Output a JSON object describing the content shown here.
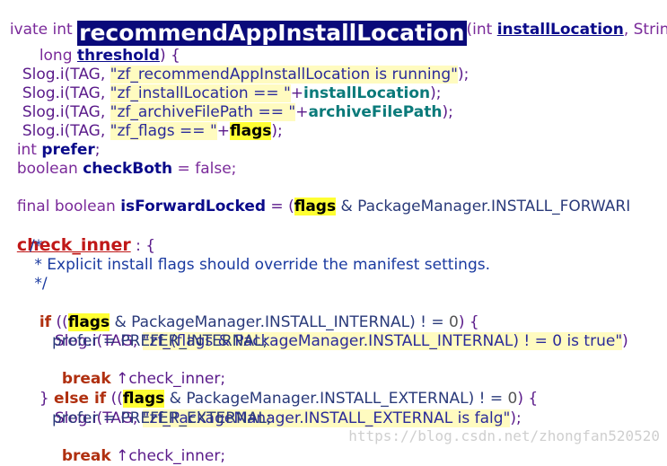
{
  "lines": {
    "l1": {
      "a": "ivate int ",
      "method": "recommendAppInstallLocation",
      "b": "(int ",
      "param1": "installLocation",
      "c": ", String"
    },
    "l2": {
      "a": "long ",
      "param": "threshold",
      "b": ") {"
    },
    "l3": {
      "a": "Slog.i(TAG, ",
      "s": "\"zf_recommendAppInstallLocation is running\"",
      "b": ");"
    },
    "l4": {
      "a": "Slog.i(TAG, ",
      "s": "\"zf_installLocation == \"",
      "plus": "+",
      "v": "installLocation",
      "b": ");"
    },
    "l5": {
      "a": "Slog.i(TAG, ",
      "s": "\"zf_archiveFilePath == \"",
      "plus": "+",
      "v": "archiveFilePath",
      "b": ");"
    },
    "l6": {
      "a": "Slog.i(TAG, ",
      "s": "\"zf_flags == \"",
      "plus": "+",
      "v": "flags",
      "b": ");"
    },
    "l7": {
      "a": "int ",
      "v": "prefer",
      "b": ";"
    },
    "l8": {
      "a": "boolean ",
      "v": "checkBoth",
      "b": " = false;"
    },
    "l9": {
      "a": "final boolean ",
      "v": "isForwardLocked",
      "b": " = (",
      "flags": "flags",
      "c": " & PackageManager.INSTALL_FORWARI"
    },
    "l10": {
      "label": "check_inner",
      "b": " : {"
    },
    "l11": {
      "t": "/*"
    },
    "l12": {
      "t": " * Explicit install flags should override the manifest settings."
    },
    "l13": {
      "t": " */"
    },
    "l14": {
      "if": "if",
      "a": " ((",
      "flags": "flags",
      "b": " & PackageManager.INSTALL_INTERNAL) ! = ",
      "num": "0",
      "c": ") {"
    },
    "l15": {
      "a": "Slog.i(TAG, ",
      "s": "\"zf_(flags & PackageManager.INSTALL_INTERNAL) ! = 0 is true\"",
      "b": ")"
    },
    "l16": {
      "a": "prefer = PREFER_INTERNAL;"
    },
    "l17": {
      "kw": "break",
      "b": " ↑check_inner;"
    },
    "l18": {
      "a": "} ",
      "elseif": "else if",
      "b": " ((",
      "flags": "flags",
      "c": " & PackageManager.INSTALL_EXTERNAL) ! = ",
      "num": "0",
      "d": ") {"
    },
    "l19": {
      "a": "Slog.i(TAG, ",
      "s": "\"zf_PackageManager.INSTALL_EXTERNAL is falg\"",
      "b": ");"
    },
    "l20": {
      "a": "prefer = PREFER_EXTERNAL;"
    },
    "l21": {
      "kw": "break",
      "b": " ↑check_inner;"
    }
  },
  "watermark": "https://blog.csdn.net/zhongfan520520"
}
